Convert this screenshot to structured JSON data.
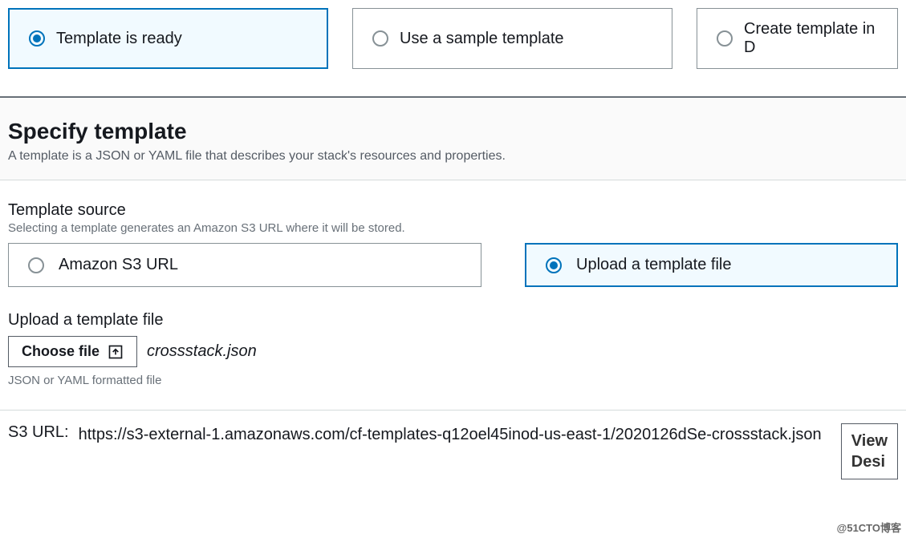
{
  "prerequisite": {
    "options": [
      "Template is ready",
      "Use a sample template",
      "Create template in D"
    ],
    "selectedIndex": 0
  },
  "specify": {
    "title": "Specify template",
    "subtitle": "A template is a JSON or YAML file that describes your stack's resources and properties."
  },
  "templateSource": {
    "label": "Template source",
    "help": "Selecting a template generates an Amazon S3 URL where it will be stored.",
    "options": [
      "Amazon S3 URL",
      "Upload a template file"
    ],
    "selectedIndex": 1
  },
  "upload": {
    "label": "Upload a template file",
    "chooseLabel": "Choose file",
    "fileName": "crossstack.json",
    "formatHelp": "JSON or YAML formatted file"
  },
  "s3": {
    "label": "S3 URL:",
    "value": "https://s3-external-1.amazonaws.com/cf-templates-q12oel45inod-us-east-1/2020126dSe-crossstack.json"
  },
  "viewButton": {
    "line1": "View",
    "line2": "Desi"
  },
  "watermark": "@51CTO博客"
}
